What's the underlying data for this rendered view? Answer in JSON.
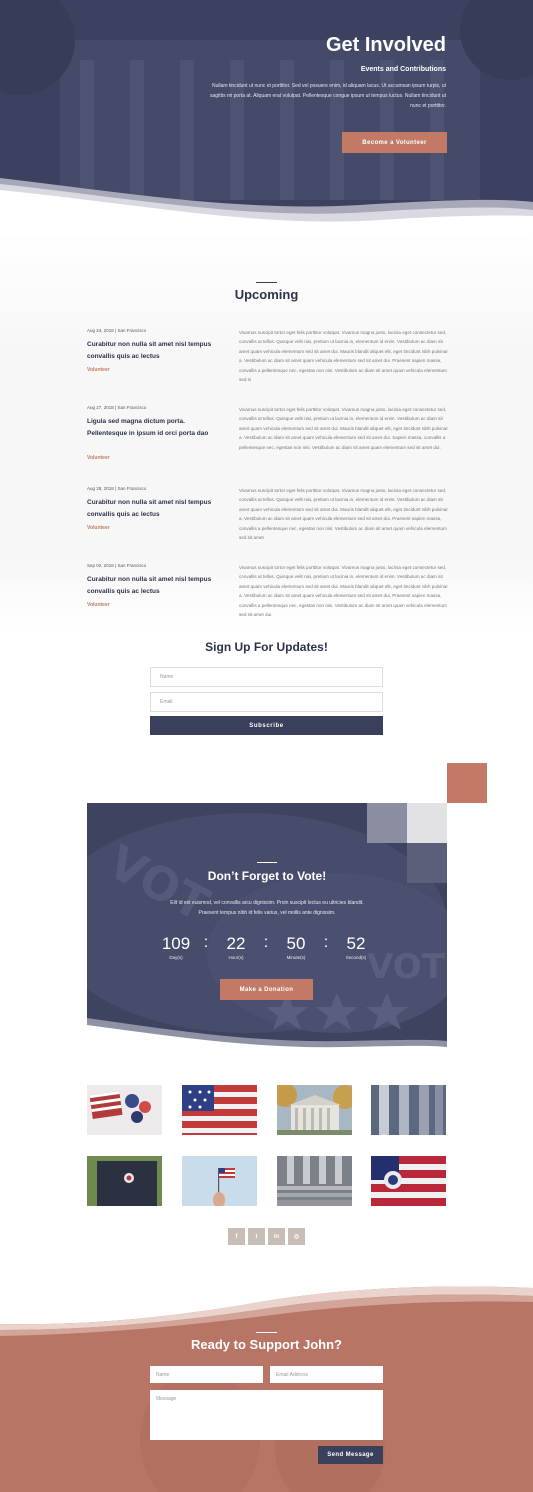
{
  "hero": {
    "title": "Get Involved",
    "subtitle": "Events and Contributions",
    "text": "Nullam tincidunt ut nunc et porttitor. Sed vel posuere enim, id aliquam lacus. Ut accumsan ipsum turpis, ut sagittis mi porta at. Aliquam erat volutpat. Pellentesque congue ipsum ut tempus luctus. Nullam tincidunt ut nunc et porttitor.",
    "button": "Become a Volunteer"
  },
  "upcoming": {
    "title": "Upcoming",
    "events": [
      {
        "meta": "Aug 24, 2018 | San Francisco",
        "title": "Curabitur non nulla sit amet nisl tempus convallis quis ac lectus",
        "link": "Volunteer",
        "desc": "Vivamus suscipit tortor eget felis porttitor volutpat. Vivamus magna justo, lacinia eget consectetur sed, convallis at tellus. Quisque velit nisi, pretium ut lacinia in, elementum id enim. Vestibulum ac diam sit amet quam vehicula elementum sed sit amet dui. Mauris blandit aliquet elit, eget tincidunt nibh pulvinar a. Vestibulum ac diam sit amet quam vehicula elementum sed sit amet dui. Praesent sapien massa, convallis a pellentesque nec, egestas non nisi. Vestibulum ac diam sit amet quam vehicula elementum sed si"
      },
      {
        "meta": "Aug 27, 2018  |  San Francisco",
        "title": "Ligula sed magna dictum porta. Pellentesque in ipsum id orci porta dao",
        "link": "Volunteer",
        "desc": "Vivamus suscipit tortor eget felis porttitor volutpat. Vivamus magna justo, lacinia eget consectetur sed, convallis at tellus. Quisque velit nisi, pretium ut lacinia in, elementum id enim. Vestibulum ac diam sit amet quam vehicula elementum sed sit amet dui. Mauris blandit aliquet elit, eget tincidunt nibh pulvinar a. Vestibulum ac diam sit amet quam vehicula elementum sed sit amet dui. Sapien massa, convallis a pellentesque nec, egestas non nisi. Vestibulum ac diam sit amet quam elementum sed sit amet dui."
      },
      {
        "meta": "Aug 28, 2018  |  San Francisco",
        "title": "Curabitur non nulla sit amet nisl tempus convallis quis ac lectus",
        "link": "Volunteer",
        "desc": "Vivamus suscipit tortor eget felis porttitor volutpat. Vivamus magna justo, lacinia eget consectetur sed, convallis at tellus. Quisque velit nisi, pretium ut lacinia in, elementum id enim. Vestibulum ac diam sit amet quam vehicula elementum sed sit amet dui. Mauris blandit aliquet elit, eget tincidunt nibh pulvinar a. Vestibulum ac diam sit amet quam vehicula elementum sed sit amet dui. Praesent sapien massa, convallis a pellentesque nec, egestas non nisi. Vestibulum ac diam sit amet quam vehicula elementum sed sit amet"
      },
      {
        "meta": "Sep 02, 2018 | San Francisco",
        "title": "Curabitur non nulla sit amet nisl tempus convallis quis ac lectus",
        "link": "Volunteer",
        "desc": "Vivamus suscipit tortor eget felis porttitor volutpat. Vivamus magna justo, lacinia eget consectetur sed, convallis at tellus. Quisque velit nisi, pretium ut lacinia in, elementum id enim. Vestibulum ac diam sit amet quam vehicula elementum sed sit amet dui. Mauris blandit aliquet elit, eget tincidunt nibh pulvinar a. Vestibulum ac diam sit amet quam vehicula elementum sed sit amet dui. Praesent sapien massa, convallis a pellentesque nec, egestas non nisi. Vestibulum ac diam sit amet quam vehicula elementum sed sit amet dui."
      }
    ]
  },
  "signup": {
    "title": "Sign Up For Updates!",
    "name_placeholder": "Name",
    "email_placeholder": "Email",
    "button": "Subscribe"
  },
  "vote": {
    "title": "Don’t Forget to Vote!",
    "text": "Elit id est euismod, vel convallis arcu dignissim. Proin suscipit lectus eu ultricies blandit. Praesent tempus nibh id felis varius, vel mollis ante dignissim.",
    "countdown": [
      {
        "value": "109",
        "label": "Day(s)"
      },
      {
        "value": "22",
        "label": "Hour(s)"
      },
      {
        "value": "50",
        "label": "Minute(s)"
      },
      {
        "value": "52",
        "label": "Second(s)"
      }
    ],
    "separator": ":",
    "button": "Make a Donation"
  },
  "social": [
    {
      "icon": "facebook-icon",
      "glyph": "f"
    },
    {
      "icon": "twitter-icon",
      "glyph": "t"
    },
    {
      "icon": "linkedin-icon",
      "glyph": "in"
    },
    {
      "icon": "instagram-icon",
      "glyph": "◎"
    }
  ],
  "support": {
    "title": "Ready to Support John?",
    "name_placeholder": "Name",
    "email_placeholder": "Email Address",
    "message_placeholder": "Message",
    "button": "Send Message"
  },
  "colors": {
    "navy": "#3a3f5c",
    "accent": "#c27a66",
    "support_bg": "#b87565"
  }
}
